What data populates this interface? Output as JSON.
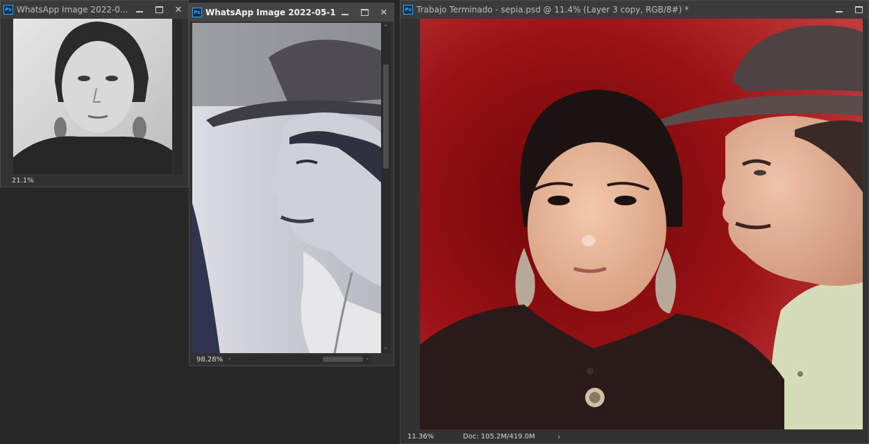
{
  "windows": [
    {
      "title": "WhatsApp Image 2022-0...",
      "zoom": "21.1%"
    },
    {
      "title": "WhatsApp Image 2022-05-1...",
      "zoom": "98.28%"
    },
    {
      "title": "Trabajo Terminado - sepia.psd @ 11.4% (Layer 3 copy, RGB/8#) *",
      "zoom": "11.36%",
      "doc_info": "Doc: 105.2M/419.0M"
    }
  ],
  "icons": {
    "app": "Ps",
    "minimize": "minimize-icon",
    "maximize": "maximize-icon",
    "close": "close-icon"
  },
  "colors": {
    "workspace": "#272727",
    "panel": "#323232",
    "accent": "#31a8ff",
    "backdrop_red": "#8e1012"
  }
}
